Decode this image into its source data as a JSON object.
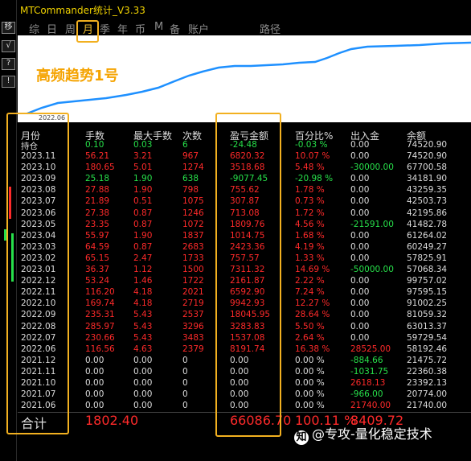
{
  "app": {
    "title": "MTCommander统计_V3.33"
  },
  "sidebar": {
    "buttons": [
      "移",
      "√",
      "?",
      "!"
    ]
  },
  "tabs": [
    "综",
    "日",
    "周",
    "月",
    "季",
    "年",
    "币",
    "M",
    "备",
    "账户",
    "路径"
  ],
  "chart": {
    "title": "高频趋势1号",
    "x_label": "2022.06"
  },
  "colors": {
    "gain": "#27e04a",
    "loss": "#ff2a2a",
    "highlight": "#f2b020"
  },
  "table": {
    "headers": {
      "month": "月份",
      "lots": "手数",
      "max_lots": "最大手数",
      "count": "次数",
      "pnl": "盈亏金额",
      "pct": "百分比%",
      "flow": "出入金",
      "balance": "余额"
    },
    "position_row": {
      "label": "持仓",
      "lots": "0.10",
      "max_lots": "0.03",
      "count": "6",
      "pnl": "-24.48",
      "pct": "-0.03 %",
      "flow": "0.00",
      "balance": "74520.90"
    },
    "rows": [
      {
        "month": "2023.11",
        "lots": "56.21",
        "max_lots": "3.21",
        "count": "967",
        "pnl": "6820.32",
        "pct": "10.07 %",
        "flow": "0.00",
        "balance": "74520.90"
      },
      {
        "month": "2023.10",
        "lots": "180.65",
        "max_lots": "5.01",
        "count": "1274",
        "pnl": "3518.68",
        "pct": "5.48 %",
        "flow": "-30000.00",
        "balance": "67700.58"
      },
      {
        "month": "2023.09",
        "lots": "25.18",
        "max_lots": "1.90",
        "count": "638",
        "pnl": "-9077.45",
        "pct": "-20.98 %",
        "flow": "0.00",
        "balance": "34181.90"
      },
      {
        "month": "2023.08",
        "lots": "27.88",
        "max_lots": "1.90",
        "count": "798",
        "pnl": "755.62",
        "pct": "1.78 %",
        "flow": "0.00",
        "balance": "43259.35"
      },
      {
        "month": "2023.07",
        "lots": "21.89",
        "max_lots": "0.51",
        "count": "1075",
        "pnl": "307.87",
        "pct": "0.73 %",
        "flow": "0.00",
        "balance": "42503.73"
      },
      {
        "month": "2023.06",
        "lots": "27.38",
        "max_lots": "0.87",
        "count": "1246",
        "pnl": "713.08",
        "pct": "1.72 %",
        "flow": "0.00",
        "balance": "42195.86"
      },
      {
        "month": "2023.05",
        "lots": "23.35",
        "max_lots": "0.87",
        "count": "1072",
        "pnl": "1809.76",
        "pct": "4.56 %",
        "flow": "-21591.00",
        "balance": "41482.78"
      },
      {
        "month": "2023.04",
        "lots": "55.97",
        "max_lots": "1.90",
        "count": "1837",
        "pnl": "1014.75",
        "pct": "1.68 %",
        "flow": "0.00",
        "balance": "61264.02"
      },
      {
        "month": "2023.03",
        "lots": "64.59",
        "max_lots": "0.87",
        "count": "2683",
        "pnl": "2423.36",
        "pct": "4.19 %",
        "flow": "0.00",
        "balance": "60249.27"
      },
      {
        "month": "2023.02",
        "lots": "65.15",
        "max_lots": "2.47",
        "count": "1733",
        "pnl": "757.57",
        "pct": "1.33 %",
        "flow": "0.00",
        "balance": "57825.91"
      },
      {
        "month": "2023.01",
        "lots": "36.37",
        "max_lots": "1.12",
        "count": "1500",
        "pnl": "7311.32",
        "pct": "14.69 %",
        "flow": "-50000.00",
        "balance": "57068.34"
      },
      {
        "month": "2022.12",
        "lots": "53.24",
        "max_lots": "1.46",
        "count": "1722",
        "pnl": "2161.87",
        "pct": "2.22 %",
        "flow": "0.00",
        "balance": "99757.02"
      },
      {
        "month": "2022.11",
        "lots": "116.20",
        "max_lots": "4.18",
        "count": "2021",
        "pnl": "6592.90",
        "pct": "7.24 %",
        "flow": "0.00",
        "balance": "97595.15"
      },
      {
        "month": "2022.10",
        "lots": "169.74",
        "max_lots": "4.18",
        "count": "2719",
        "pnl": "9942.93",
        "pct": "12.27 %",
        "flow": "0.00",
        "balance": "91002.25"
      },
      {
        "month": "2022.09",
        "lots": "235.31",
        "max_lots": "5.43",
        "count": "2537",
        "pnl": "18045.95",
        "pct": "28.64 %",
        "flow": "0.00",
        "balance": "81059.32"
      },
      {
        "month": "2022.08",
        "lots": "285.97",
        "max_lots": "5.43",
        "count": "3296",
        "pnl": "3283.83",
        "pct": "5.50 %",
        "flow": "0.00",
        "balance": "63013.37"
      },
      {
        "month": "2022.07",
        "lots": "230.66",
        "max_lots": "5.43",
        "count": "3483",
        "pnl": "1537.08",
        "pct": "2.64 %",
        "flow": "0.00",
        "balance": "59729.54"
      },
      {
        "month": "2022.06",
        "lots": "116.56",
        "max_lots": "4.63",
        "count": "2379",
        "pnl": "8191.74",
        "pct": "16.38 %",
        "flow": "28525.00",
        "balance": "58192.46"
      },
      {
        "month": "2021.12",
        "lots": "0.00",
        "max_lots": "0.00",
        "count": "0",
        "pnl": "0.00",
        "pct": "0.00 %",
        "flow": "-884.66",
        "balance": "21475.72"
      },
      {
        "month": "2021.11",
        "lots": "0.00",
        "max_lots": "0.00",
        "count": "0",
        "pnl": "0.00",
        "pct": "0.00 %",
        "flow": "-1031.75",
        "balance": "22360.38"
      },
      {
        "month": "2021.10",
        "lots": "0.00",
        "max_lots": "0.00",
        "count": "0",
        "pnl": "0.00",
        "pct": "0.00 %",
        "flow": "2618.13",
        "balance": "23392.13"
      },
      {
        "month": "2021.07",
        "lots": "0.00",
        "max_lots": "0.00",
        "count": "0",
        "pnl": "0.00",
        "pct": "0.00 %",
        "flow": "-966.00",
        "balance": "20774.00"
      },
      {
        "month": "2021.06",
        "lots": "0.00",
        "max_lots": "0.00",
        "count": "0",
        "pnl": "0.00",
        "pct": "0.00 %",
        "flow": "21740.00",
        "balance": "21740.00"
      }
    ],
    "total": {
      "label": "合计",
      "lots": "1802.40",
      "pnl": "66086.70",
      "pct": "100.11 %",
      "flow": "8409.72"
    }
  },
  "watermark": {
    "icon": "知",
    "text": "@专攻-量化稳定技术"
  }
}
